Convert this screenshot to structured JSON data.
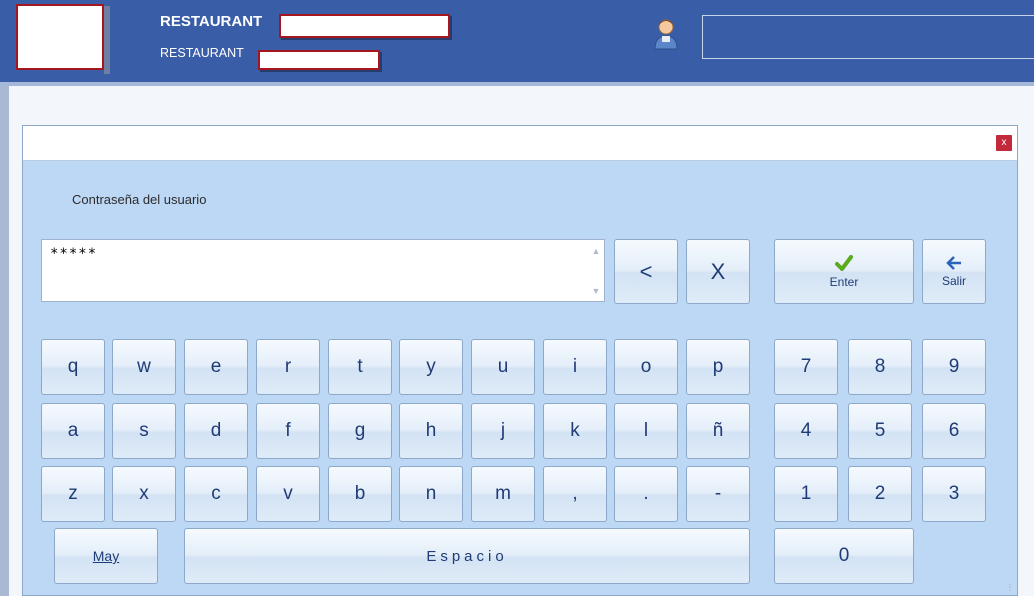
{
  "header": {
    "title": "RESTAURANT",
    "subtitle": "RESTAURANT",
    "user_icon": "user-icon",
    "brand_color": "#3a5da8"
  },
  "dialog": {
    "close_label": "x",
    "prompt": "Contraseña del usuario",
    "password_value": "*****",
    "backspace_label": "<",
    "clear_label": "X",
    "enter_label": "Enter",
    "exit_label": "Salir",
    "keys_row1": [
      "q",
      "w",
      "e",
      "r",
      "t",
      "y",
      "u",
      "i",
      "o",
      "p"
    ],
    "keys_row2": [
      "a",
      "s",
      "d",
      "f",
      "g",
      "h",
      "j",
      "k",
      "l",
      "ñ"
    ],
    "keys_row3": [
      "z",
      "x",
      "c",
      "v",
      "b",
      "n",
      "m",
      ",",
      ".",
      "-"
    ],
    "numpad": [
      "7",
      "8",
      "9",
      "4",
      "5",
      "6",
      "1",
      "2",
      "3"
    ],
    "zero_label": "0",
    "shift_label": "May",
    "space_label": "Espacio"
  }
}
